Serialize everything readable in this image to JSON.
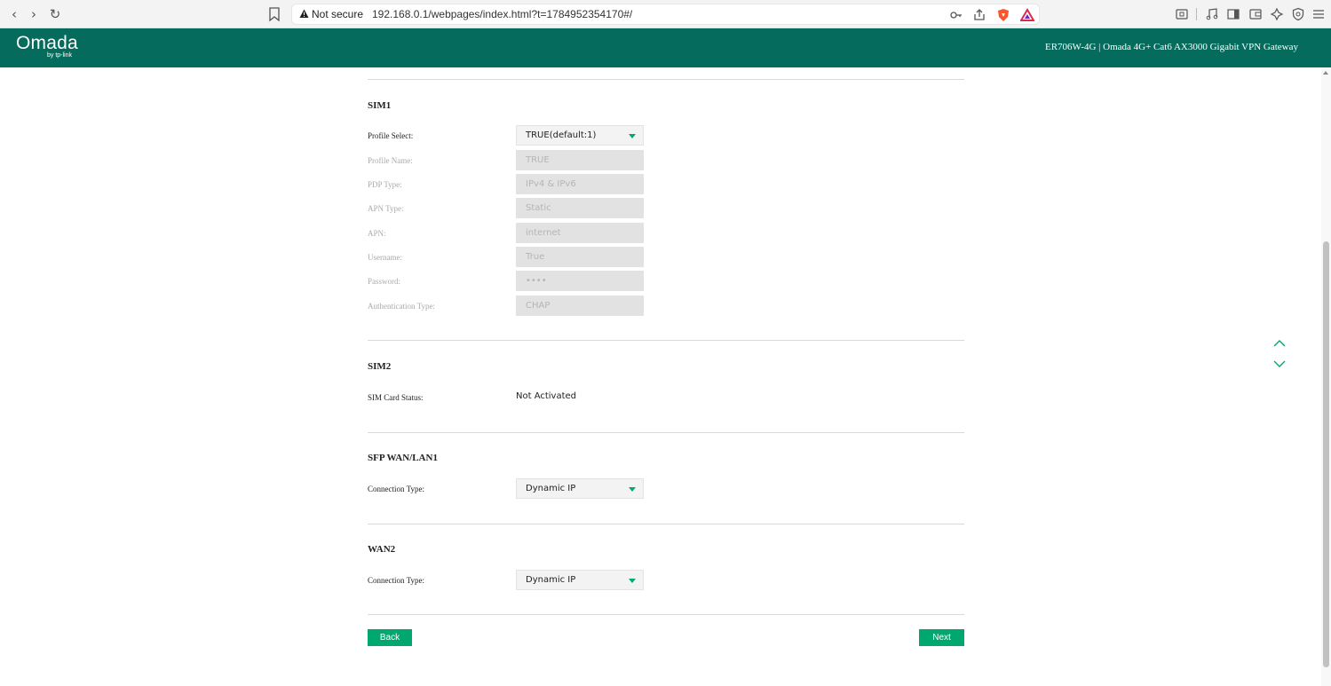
{
  "browser": {
    "back_glyph": "‹",
    "forward_glyph": "›",
    "reload_glyph": "↻",
    "not_secure": "Not secure",
    "url": "192.168.0.1/webpages/index.html?t=1784952354170#/"
  },
  "header": {
    "logo": "Omada",
    "logo_sub": "by tp-link",
    "device_title": "ER706W-4G  |  Omada 4G+ Cat6 AX3000 Gigabit VPN Gateway"
  },
  "sim1": {
    "title": "SIM1",
    "profile_select": {
      "label": "Profile Select:",
      "value": "TRUE(default:1)"
    },
    "profile_name": {
      "label": "Profile Name:",
      "value": "TRUE"
    },
    "pdp_type": {
      "label": "PDP Type:",
      "value": "IPv4 & IPv6"
    },
    "apn_type": {
      "label": "APN Type:",
      "value": "Static"
    },
    "apn": {
      "label": "APN:",
      "value": "internet"
    },
    "username": {
      "label": "Username:",
      "value": "True"
    },
    "password": {
      "label": "Password:",
      "value": "••••"
    },
    "auth_type": {
      "label": "Authentication Type:",
      "value": "CHAP"
    }
  },
  "sim2": {
    "title": "SIM2",
    "status_label": "SIM Card Status:",
    "status_value": "Not Activated"
  },
  "sfp_wan": {
    "title": "SFP WAN/LAN1",
    "connection_label": "Connection Type:",
    "connection_value": "Dynamic IP"
  },
  "wan2": {
    "title": "WAN2",
    "connection_label": "Connection Type:",
    "connection_value": "Dynamic IP"
  },
  "actions": {
    "back": "Back",
    "next": "Next"
  },
  "colors": {
    "header_bg": "#056b5c",
    "accent": "#00a870"
  }
}
